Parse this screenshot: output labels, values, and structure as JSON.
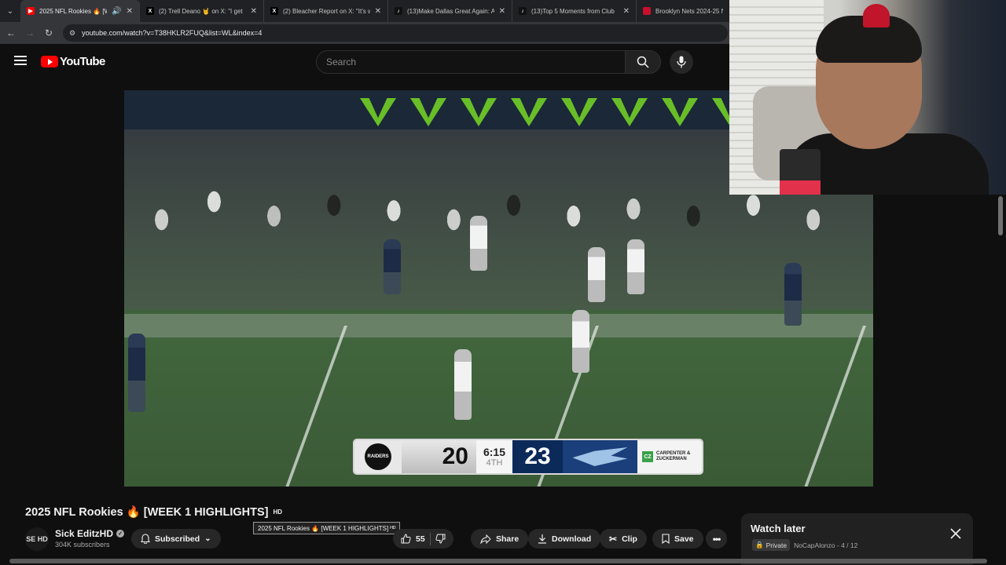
{
  "browser": {
    "tabs": [
      {
        "title": "2025 NFL Rookies 🔥 [WEE",
        "icon": "youtube-icon",
        "active": true
      },
      {
        "title": "(2) Trell Deano 🤘 on X: \"I get",
        "icon": "x-icon",
        "active": false
      },
      {
        "title": "(2) Bleacher Report on X: \"It's w",
        "icon": "x-icon",
        "active": false
      },
      {
        "title": "(13)Make Dallas Great Again: A",
        "icon": "tiktok-icon",
        "active": false
      },
      {
        "title": "(13)Top 5 Moments from Club",
        "icon": "tiktok-icon",
        "active": false
      },
      {
        "title": "Brooklyn Nets 2024-25 N",
        "icon": "bookmark-icon",
        "active": false
      }
    ],
    "url": "youtube.com/watch?v=T38HKLR2FUQ&list=WL&index=4"
  },
  "youtube": {
    "logo_text": "YouTube",
    "search_placeholder": "Search"
  },
  "video": {
    "scoreboard": {
      "away_team": "RAIDERS",
      "away_score": "20",
      "clock": "6:15",
      "quarter": "4TH",
      "home_score": "23",
      "sponsor_badge": "CZ",
      "sponsor_line1": "CARPENTER &",
      "sponsor_line2": "ZUCKERMAN"
    }
  },
  "info": {
    "title": "2025 NFL Rookies 🔥 [WEEK 1 HIGHLIGHTS]",
    "hd_badge": "HD",
    "tooltip": "2025 NFL Rookies 🔥 [WEEK 1 HIGHLIGHTS] ᴴᴰ",
    "channel_avatar_text": "SE HD",
    "channel_name": "Sick EditzHD",
    "subscribers": "304K subscribers",
    "subscribed_label": "Subscribed",
    "like_count": "55",
    "share_label": "Share",
    "download_label": "Download",
    "clip_label": "Clip",
    "save_label": "Save"
  },
  "watch_later": {
    "title": "Watch later",
    "privacy": "Private",
    "owner_and_position": "NoCapAlonzo - 4 / 12"
  },
  "colors": {
    "background": "#0f0f0f",
    "brand_red": "#ff0000",
    "pill_bg": "#272727"
  }
}
